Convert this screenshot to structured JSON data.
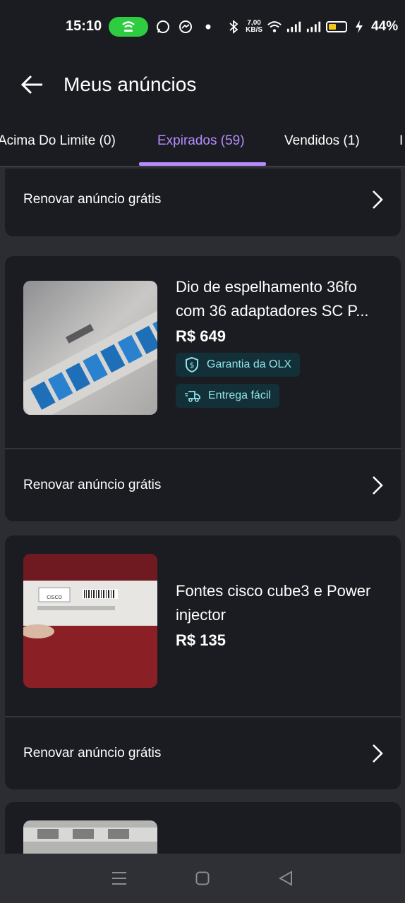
{
  "status": {
    "time": "15:10",
    "net_speed_top": "7,00",
    "net_speed_bottom": "KB/S",
    "battery": "44%"
  },
  "header": {
    "title": "Meus anúncios"
  },
  "tabs": [
    {
      "label": "Acima Do Limite (0)"
    },
    {
      "label": "Expirados (59)"
    },
    {
      "label": "Vendidos (1)"
    },
    {
      "label": "I"
    }
  ],
  "renew_label": "Renovar anúncio grátis",
  "listings": [
    {
      "title_line1": "Dio de espelhamento 36fo",
      "title_line2": "com 36 adaptadores SC P...",
      "price": "R$ 649",
      "badges": [
        "Garantia da OLX",
        "Entrega fácil"
      ]
    },
    {
      "title_line1": "Fontes cisco cube3 e Power",
      "title_line2": "injector",
      "price": "R$ 135",
      "thumb_text": "CISCO"
    }
  ],
  "colors": {
    "accent": "#b58cff",
    "badge_bg": "#133038",
    "badge_text": "#8fe3ea",
    "card_bg": "#1b1c21"
  }
}
